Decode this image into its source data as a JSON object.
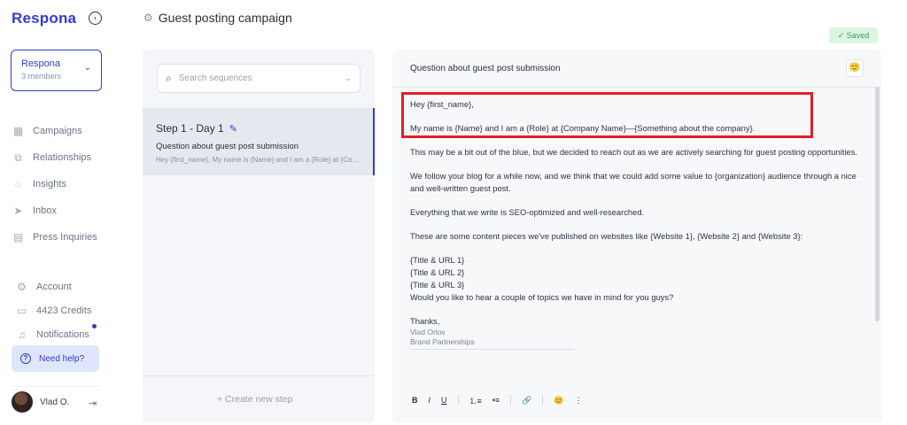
{
  "sidebar": {
    "logo": "Respona",
    "team": {
      "name": "Respona",
      "members": "3 members"
    },
    "nav": [
      {
        "label": "Campaigns",
        "icon": "campaigns-icon"
      },
      {
        "label": "Relationships",
        "icon": "relationships-icon"
      },
      {
        "label": "Insights",
        "icon": "insights-icon"
      },
      {
        "label": "Inbox",
        "icon": "inbox-icon"
      },
      {
        "label": "Press Inquiries",
        "icon": "press-icon"
      }
    ],
    "bottom": [
      {
        "label": "Account",
        "icon": "gear-icon"
      },
      {
        "label": "4423 Credits",
        "icon": "credits-icon"
      },
      {
        "label": "Notifications",
        "icon": "bell-icon"
      }
    ],
    "help": "Need help?",
    "user": "Vlad O."
  },
  "header": {
    "title": "Guest posting campaign",
    "status": "✓ Saved"
  },
  "sequences": {
    "search_placeholder": "Search sequences",
    "steps": [
      {
        "title": "Step 1 - Day 1",
        "subject": "Question about guest post submission",
        "preview": "Hey {first_name}, My name is {Name} and I am a {Role} at {Company Name}—{Something about the company}."
      }
    ],
    "create": "+ Create new step"
  },
  "editor": {
    "subject": "Question about guest post submission",
    "body": {
      "greeting": "Hey {first_name},",
      "intro": "My name is {Name} and I am a {Role} at {Company Name}—{Something about the company}.",
      "p1": "This may be a bit out of the blue, but we decided to reach out as we are actively searching for guest posting opportunities.",
      "p2": "We follow your blog for a while now, and we think that we could add some value to {organization} audience through a nice and well-written guest post.",
      "p3": "Everything that we write is SEO-optimized and well-researched.",
      "p4": "These are some content pieces we've published on websites like {Website 1}, {Website 2} and {Website 3}:",
      "links": [
        "{Title & URL 1}",
        "{Title & URL 2}",
        "{Title & URL 3}"
      ],
      "question": "Would you like to hear a couple of topics we have in mind for you guys?",
      "thanks": "Thanks,",
      "sig_name": "Vlad Orlov",
      "sig_title": "Brand Partnerships"
    },
    "toolbar": {
      "bold": "B",
      "italic": "I",
      "underline": "U"
    }
  },
  "colors": {
    "brand": "#2f3dcc",
    "highlight": "#e0202a",
    "saved_bg": "#dcf5e3",
    "saved_text": "#2fa35a"
  }
}
